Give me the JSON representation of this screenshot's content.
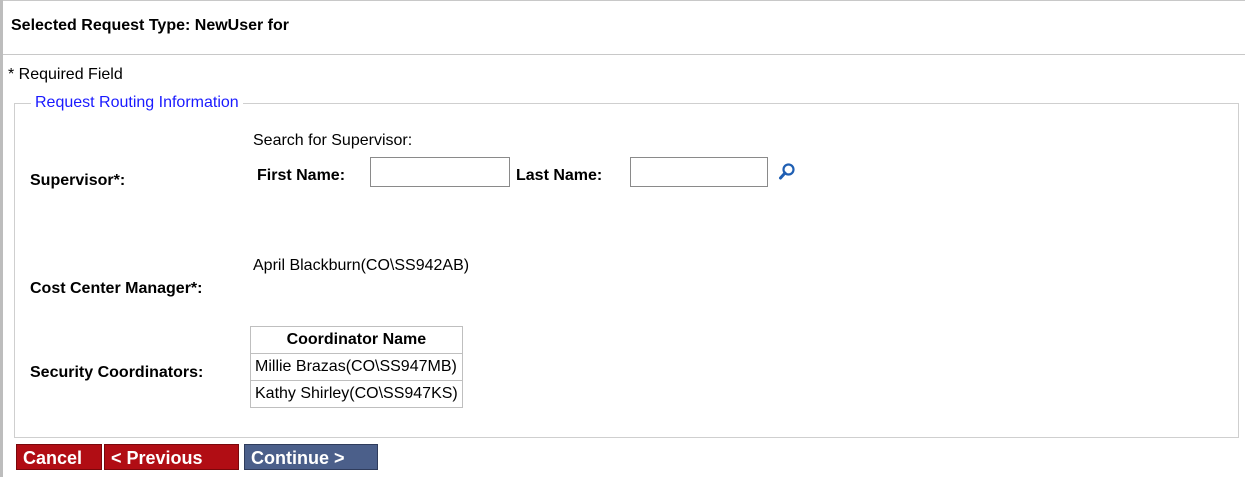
{
  "header": {
    "title": "Selected Request Type: NewUser for"
  },
  "required_note": "* Required Field",
  "routing": {
    "legend": "Request Routing Information",
    "supervisor": {
      "label": "Supervisor*:",
      "search_caption": "Search for Supervisor:",
      "first_name_label": "First Name:",
      "first_name_value": "",
      "last_name_label": "Last Name:",
      "last_name_value": "",
      "search_icon": "search-icon"
    },
    "cost_center_manager": {
      "label": "Cost Center Manager*:",
      "value": "April Blackburn(CO\\SS942AB)"
    },
    "security_coordinators": {
      "label": "Security Coordinators:",
      "column_header": "Coordinator Name",
      "rows": [
        "Millie Brazas(CO\\SS947MB)",
        "Kathy Shirley(CO\\SS947KS)"
      ]
    }
  },
  "buttons": {
    "cancel": "Cancel",
    "previous": "< Previous",
    "continue": "Continue >"
  },
  "colors": {
    "legend": "#1a1aff",
    "cancel_bg": "#b10d14",
    "continue_bg": "#4b5f8a"
  }
}
